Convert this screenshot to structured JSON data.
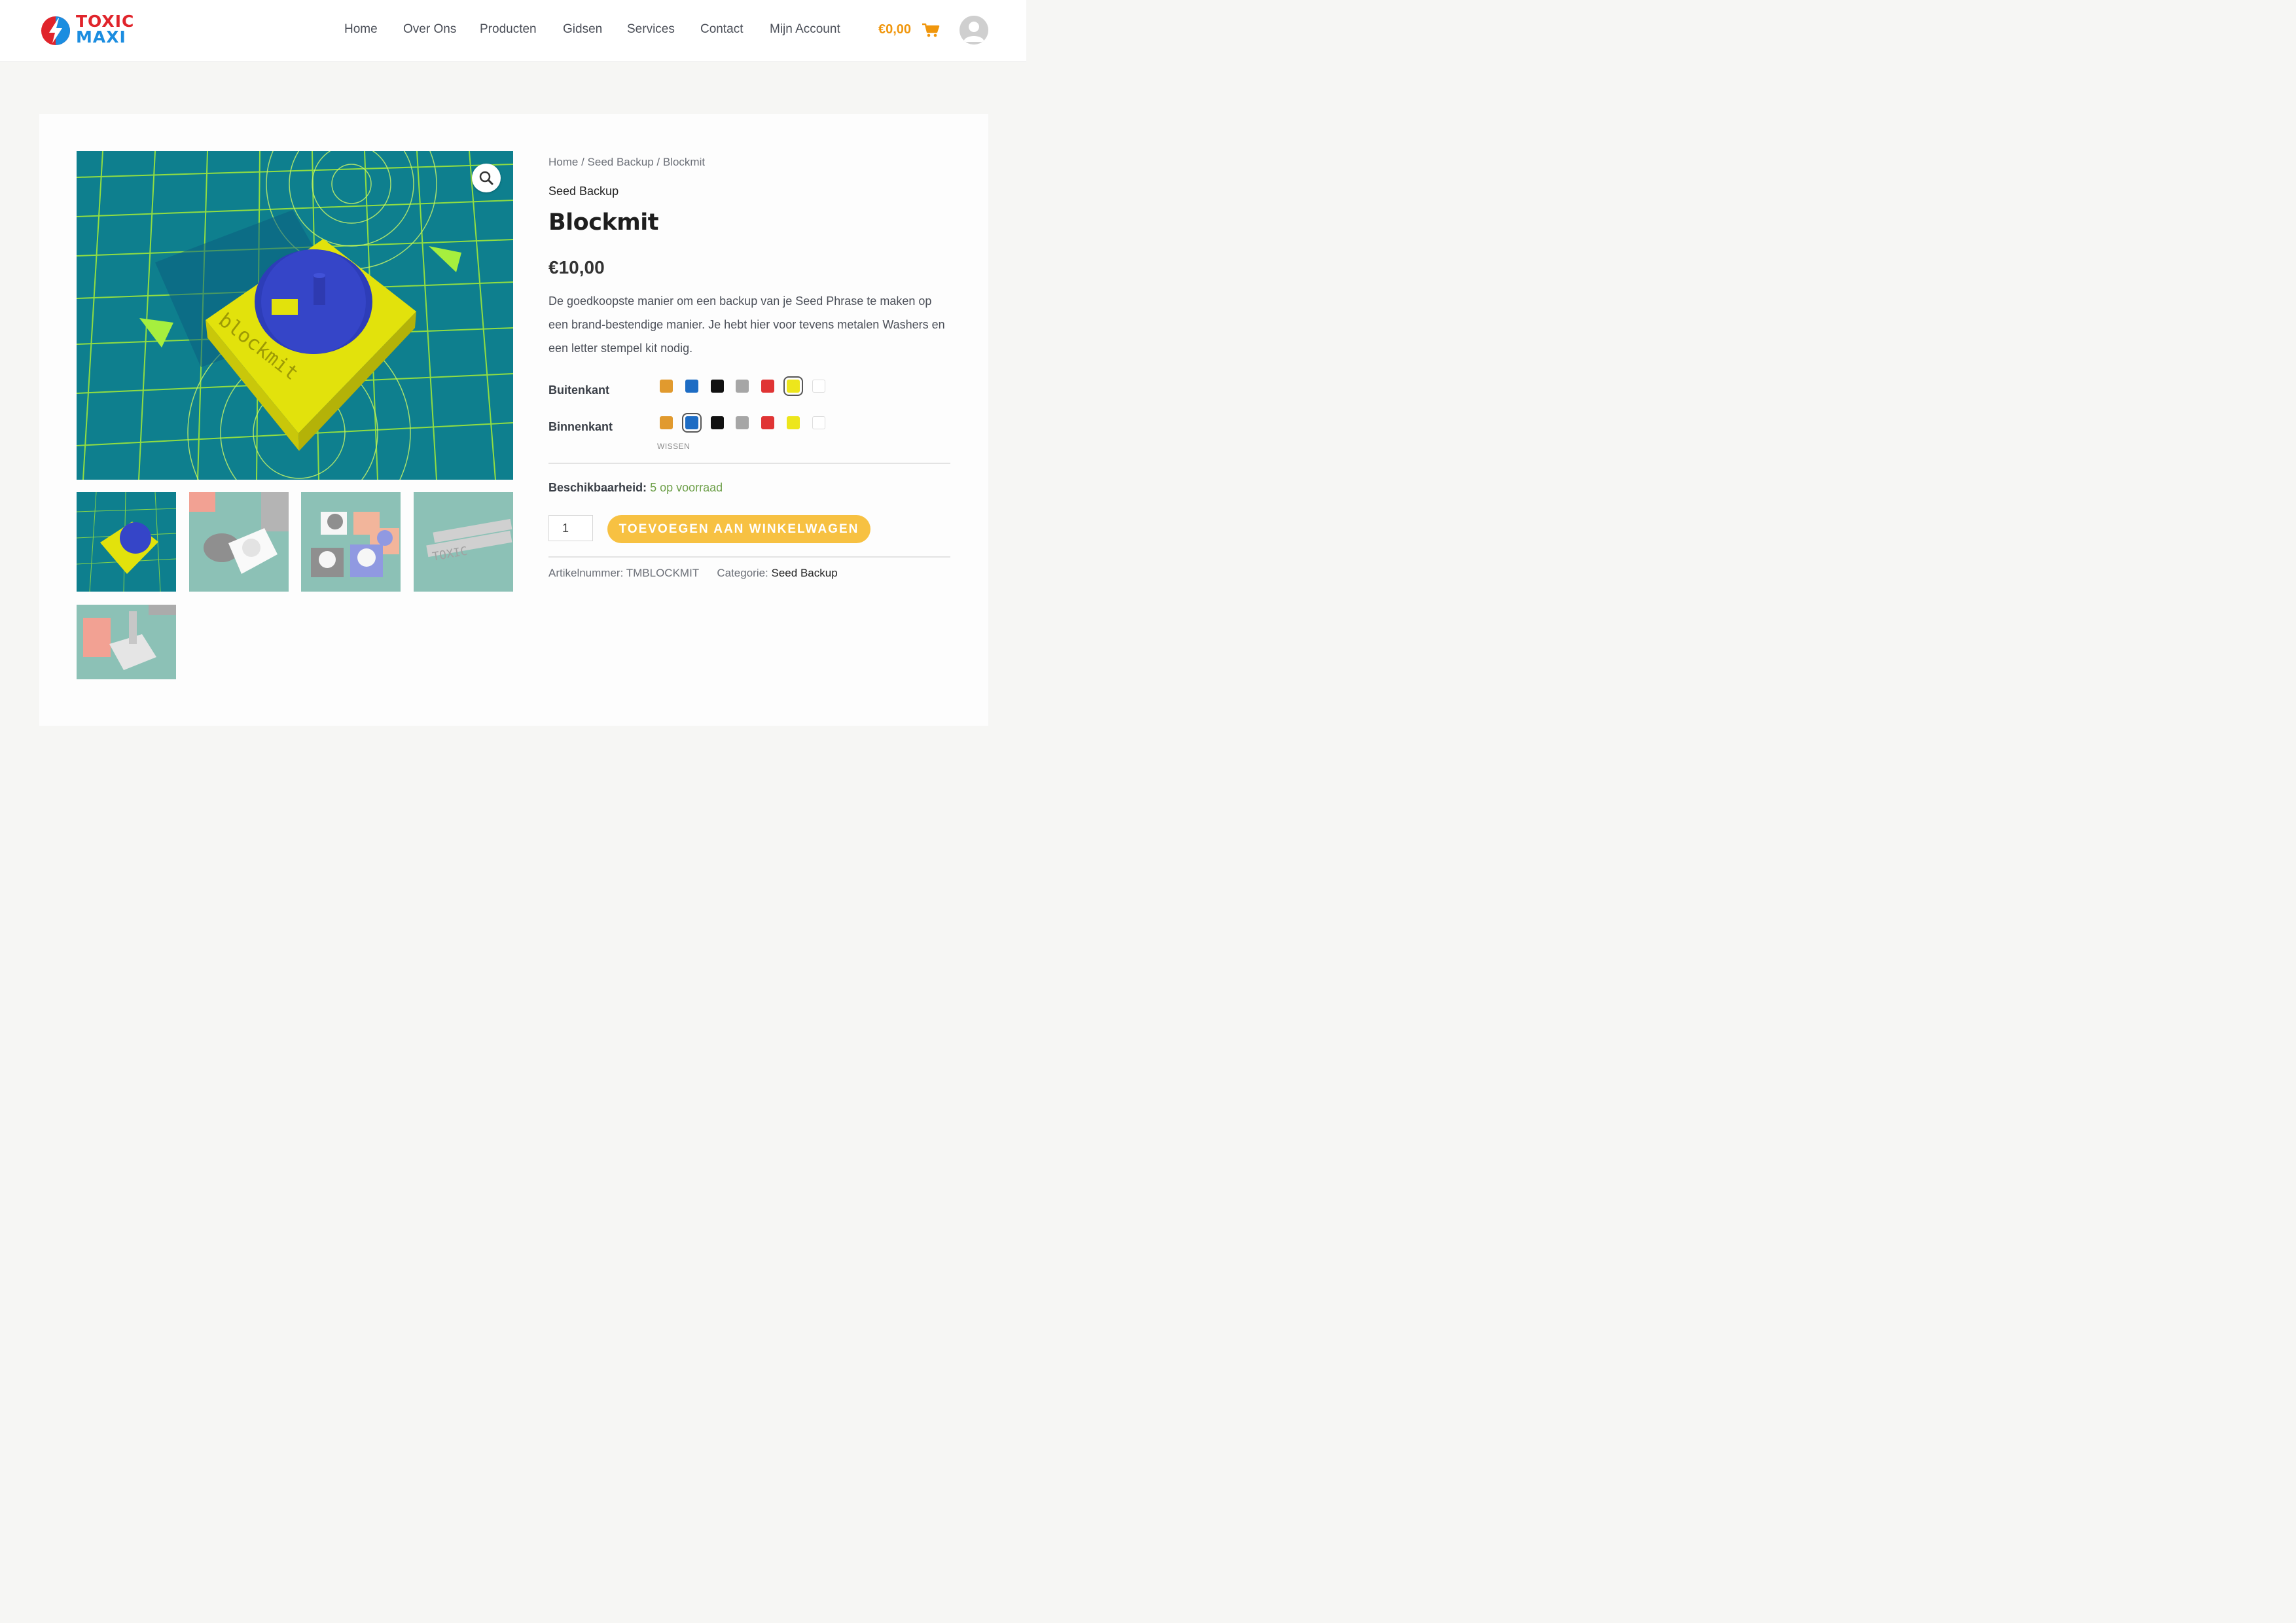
{
  "header": {
    "logo": {
      "line1": "TOXIC",
      "line2": "MAXI"
    },
    "nav": [
      "Home",
      "Over Ons",
      "Producten",
      "Gidsen",
      "Services",
      "Contact",
      "Mijn Account"
    ],
    "cart_total": "€0,00",
    "icons": {
      "cart": "cart-icon",
      "avatar": "user-avatar-icon"
    }
  },
  "product": {
    "breadcrumb": [
      "Home",
      "Seed Backup",
      "Blockmit"
    ],
    "breadcrumb_sep": " / ",
    "category_top": "Seed Backup",
    "title": "Blockmit",
    "price": "€10,00",
    "description": "De goedkoopste manier om een backup van je Seed Phrase te maken op een brand-bestendige manier. Je hebt hier voor tevens metalen Washers en een letter stempel kit nodig.",
    "attributes": [
      {
        "label": "Buitenkant",
        "colors": [
          "#e19a2e",
          "#1d6cc4",
          "#111111",
          "#a6a6a6",
          "#e03434",
          "#ede61c",
          "#ffffff"
        ],
        "selected": 5
      },
      {
        "label": "Binnenkant",
        "colors": [
          "#e19a2e",
          "#1d6cc4",
          "#111111",
          "#a6a6a6",
          "#e03434",
          "#ede61c",
          "#ffffff"
        ],
        "selected": 1
      }
    ],
    "clear_label": "WISSEN",
    "availability_label": "Beschikbaarheid:",
    "availability_value": "5 op voorraad",
    "quantity": "1",
    "add_to_cart": "TOEVOEGEN AAN WINKELWAGEN",
    "sku_label": "Artikelnummer:",
    "sku": "TMBLOCKMIT",
    "category_label": "Categorie:",
    "category": "Seed Backup",
    "image_engraving": "blockmit",
    "thumb4_text": "TOXIC"
  }
}
